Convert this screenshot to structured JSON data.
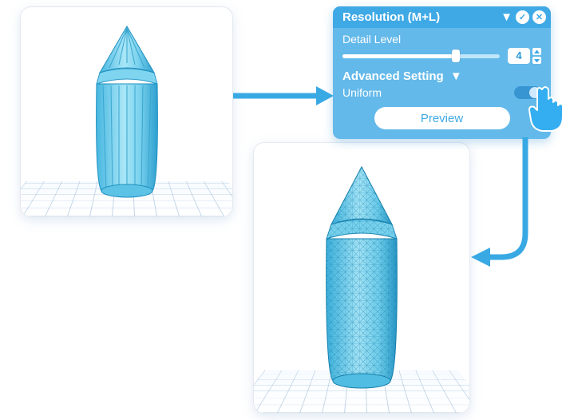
{
  "panel": {
    "title": "Resolution (M+L)",
    "detail_label": "Detail Level",
    "detail_value": "4",
    "advanced_label": "Advanced Setting",
    "uniform_label": "Uniform",
    "uniform_on": true,
    "preview_label": "Preview"
  },
  "viewport_a": {
    "description": "low-poly cylindrical 3D object"
  },
  "viewport_b": {
    "description": "high-resolution subdivided version of the same 3D object"
  },
  "flow": {
    "a_to_panel": "arrow from first viewport to settings panel",
    "panel_to_b": "arrow from settings panel to second viewport"
  }
}
